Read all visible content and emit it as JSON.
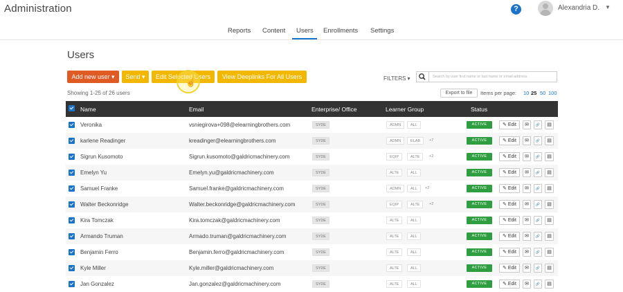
{
  "app": {
    "title": "Administration"
  },
  "header": {
    "help_icon": "question-circle-icon",
    "help_glyph": "?",
    "user_name": "Alexandria D.",
    "caret": "▼"
  },
  "nav": {
    "tabs": [
      "Reports",
      "Content",
      "Users",
      "Enrollments",
      "Settings"
    ],
    "active": "Users"
  },
  "page": {
    "title": "Users"
  },
  "toolbar": {
    "add_label": "Add new user ▾",
    "send_label": "Send ▾",
    "edit_label": "Edit Selected Users",
    "deeplinks_label": "View Deeplinks For All Users",
    "filters_label": "FILTERS ▾",
    "search_placeholder": "Search by user first name or last name or email address",
    "hand_glyph": "☝"
  },
  "summary": {
    "showing": "Showing 1-25 of 26 users",
    "export_label": "Export to file",
    "items_per_page_label": "Items per page:",
    "page_sizes": [
      "10",
      "25",
      "50",
      "100"
    ],
    "selected_size": "25"
  },
  "table": {
    "headers": {
      "name": "Name",
      "email": "Email",
      "enterprise": "Enterprise/ Office",
      "group": "Learner Group",
      "status": "Status"
    },
    "action_labels": {
      "edit": "Edit",
      "edit_glyph": "✎",
      "mail_glyph": "✉",
      "link_glyph": "🔗",
      "doc_glyph": "▤"
    },
    "rows": [
      {
        "name": "Veronika",
        "email": "vsniegirova+098@elearningbrothers.com",
        "enterprise": "SYDE",
        "groups": [
          "ADMN",
          "ALL"
        ],
        "more": "",
        "status": "ACTIVE"
      },
      {
        "name": "karlene Readinger",
        "email": "kreadinger@elearningbrothers.com",
        "enterprise": "SYDE",
        "groups": [
          "ADMN",
          "ELAB"
        ],
        "more": "+7",
        "status": "ACTIVE"
      },
      {
        "name": "Sigrun Kusomoto",
        "email": "Sigrun.kusomoto@galdricmachinery.com",
        "enterprise": "SYDE",
        "groups": [
          "EQIP",
          "ALTE"
        ],
        "more": "+2",
        "status": "ACTIVE"
      },
      {
        "name": "Emelyn Yu",
        "email": "Emelyn.yu@galdricmachinery.com",
        "enterprise": "SYDE",
        "groups": [
          "ALTE",
          "ALL"
        ],
        "more": "",
        "status": "ACTIVE"
      },
      {
        "name": "Samuel Franke",
        "email": "Samuel.franke@galdricmachinery.com",
        "enterprise": "SYDE",
        "groups": [
          "ADMN",
          "ALL"
        ],
        "more": "+2",
        "status": "ACTIVE"
      },
      {
        "name": "Walter Beckonridge",
        "email": "Walter.beckonridge@galdricmachinery.com",
        "enterprise": "SYDE",
        "groups": [
          "EQIP",
          "ALTE"
        ],
        "more": "+2",
        "status": "ACTIVE"
      },
      {
        "name": "Kira Tomczak",
        "email": "Kira.tomczak@galdricmachinery.com",
        "enterprise": "SYDE",
        "groups": [
          "ALTE",
          "ALL"
        ],
        "more": "",
        "status": "ACTIVE"
      },
      {
        "name": "Armando Truman",
        "email": "Armado.truman@galdricmachinery.com",
        "enterprise": "SYDE",
        "groups": [
          "ALTE",
          "ALL"
        ],
        "more": "",
        "status": "ACTIVE"
      },
      {
        "name": "Benjamin Ferro",
        "email": "Benjamin.ferro@galdricmachinery.com",
        "enterprise": "SYDE",
        "groups": [
          "ALTE",
          "ALL"
        ],
        "more": "",
        "status": "ACTIVE"
      },
      {
        "name": "Kyle Miller",
        "email": "Kyle.miller@galdricmachinery.com",
        "enterprise": "SYDE",
        "groups": [
          "ALTE",
          "ALL"
        ],
        "more": "",
        "status": "ACTIVE"
      },
      {
        "name": "Jan Gonzalez",
        "email": "Jan.gonzalez@galdricmachinery.com",
        "enterprise": "SYDE",
        "groups": [
          "ALTE",
          "ALL"
        ],
        "more": "",
        "status": "ACTIVE"
      }
    ]
  },
  "colors": {
    "primary": "#1a73c9",
    "add_button": "#e05a23",
    "yellow_button": "#f2b700",
    "active_status": "#2e9e41",
    "table_header": "#333333"
  }
}
